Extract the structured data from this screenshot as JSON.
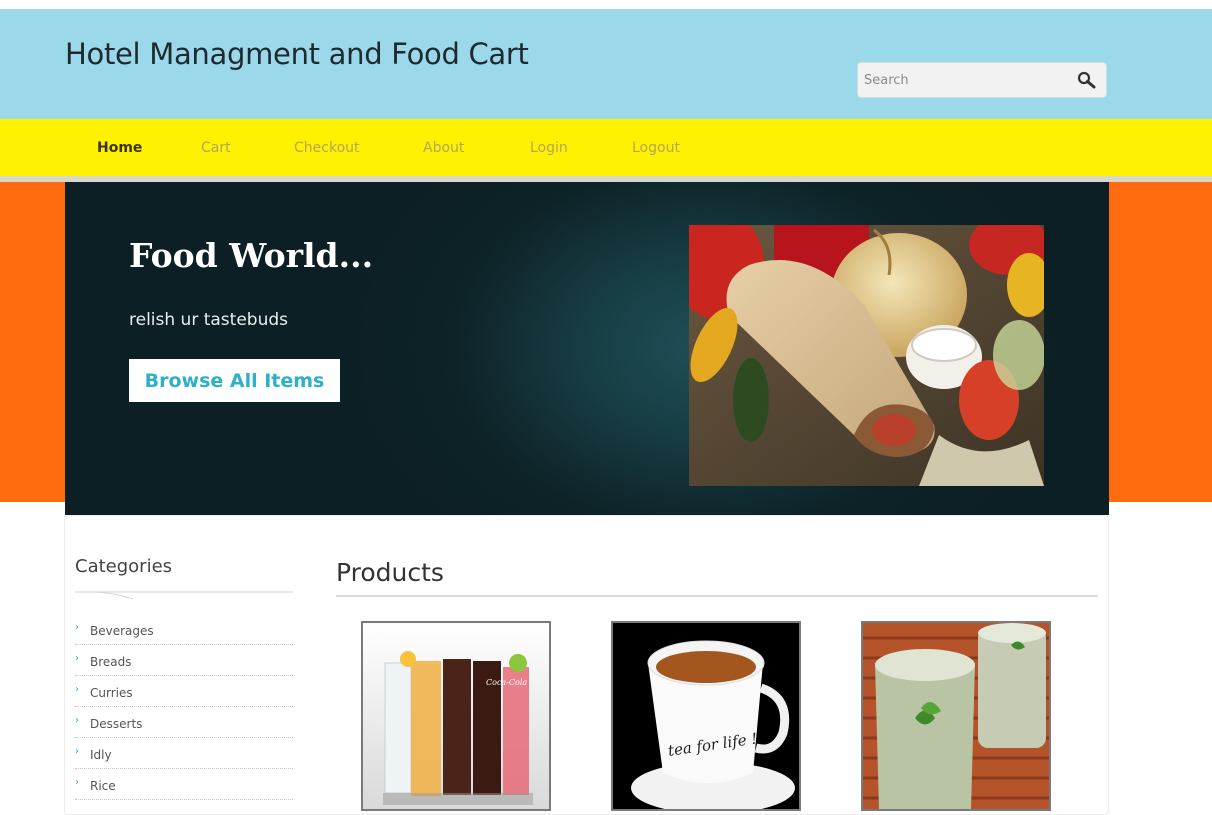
{
  "header": {
    "site_title": "Hotel Managment and Food Cart",
    "search_placeholder": "Search"
  },
  "nav": {
    "items": [
      {
        "label": "Home",
        "active": true
      },
      {
        "label": "Cart",
        "active": false
      },
      {
        "label": "Checkout",
        "active": false
      },
      {
        "label": "About",
        "active": false
      },
      {
        "label": "Login",
        "active": false
      },
      {
        "label": "Logout",
        "active": false
      }
    ]
  },
  "banner": {
    "title": "Food World...",
    "tagline": "relish ur tastebuds",
    "button_label": "Browse All Items"
  },
  "sidebar": {
    "title": "Categories",
    "categories": [
      "Beverages",
      "Breads",
      "Curries",
      "Desserts",
      "Idly",
      "Rice"
    ]
  },
  "products": {
    "title": "Products",
    "items": [
      {
        "image": "cold-drinks-glasses-image",
        "cup_text": "Coca-Cola"
      },
      {
        "image": "tea-cup-image",
        "cup_text": "tea for life !"
      },
      {
        "image": "lassi-glasses-image",
        "cup_text": ""
      }
    ]
  },
  "colors": {
    "header_bg": "#9bd8e9",
    "nav_bg": "#fff200",
    "orange_band": "#ff6b0e",
    "banner_bg": "#0d2328",
    "accent_button_text": "#2db0c8"
  }
}
